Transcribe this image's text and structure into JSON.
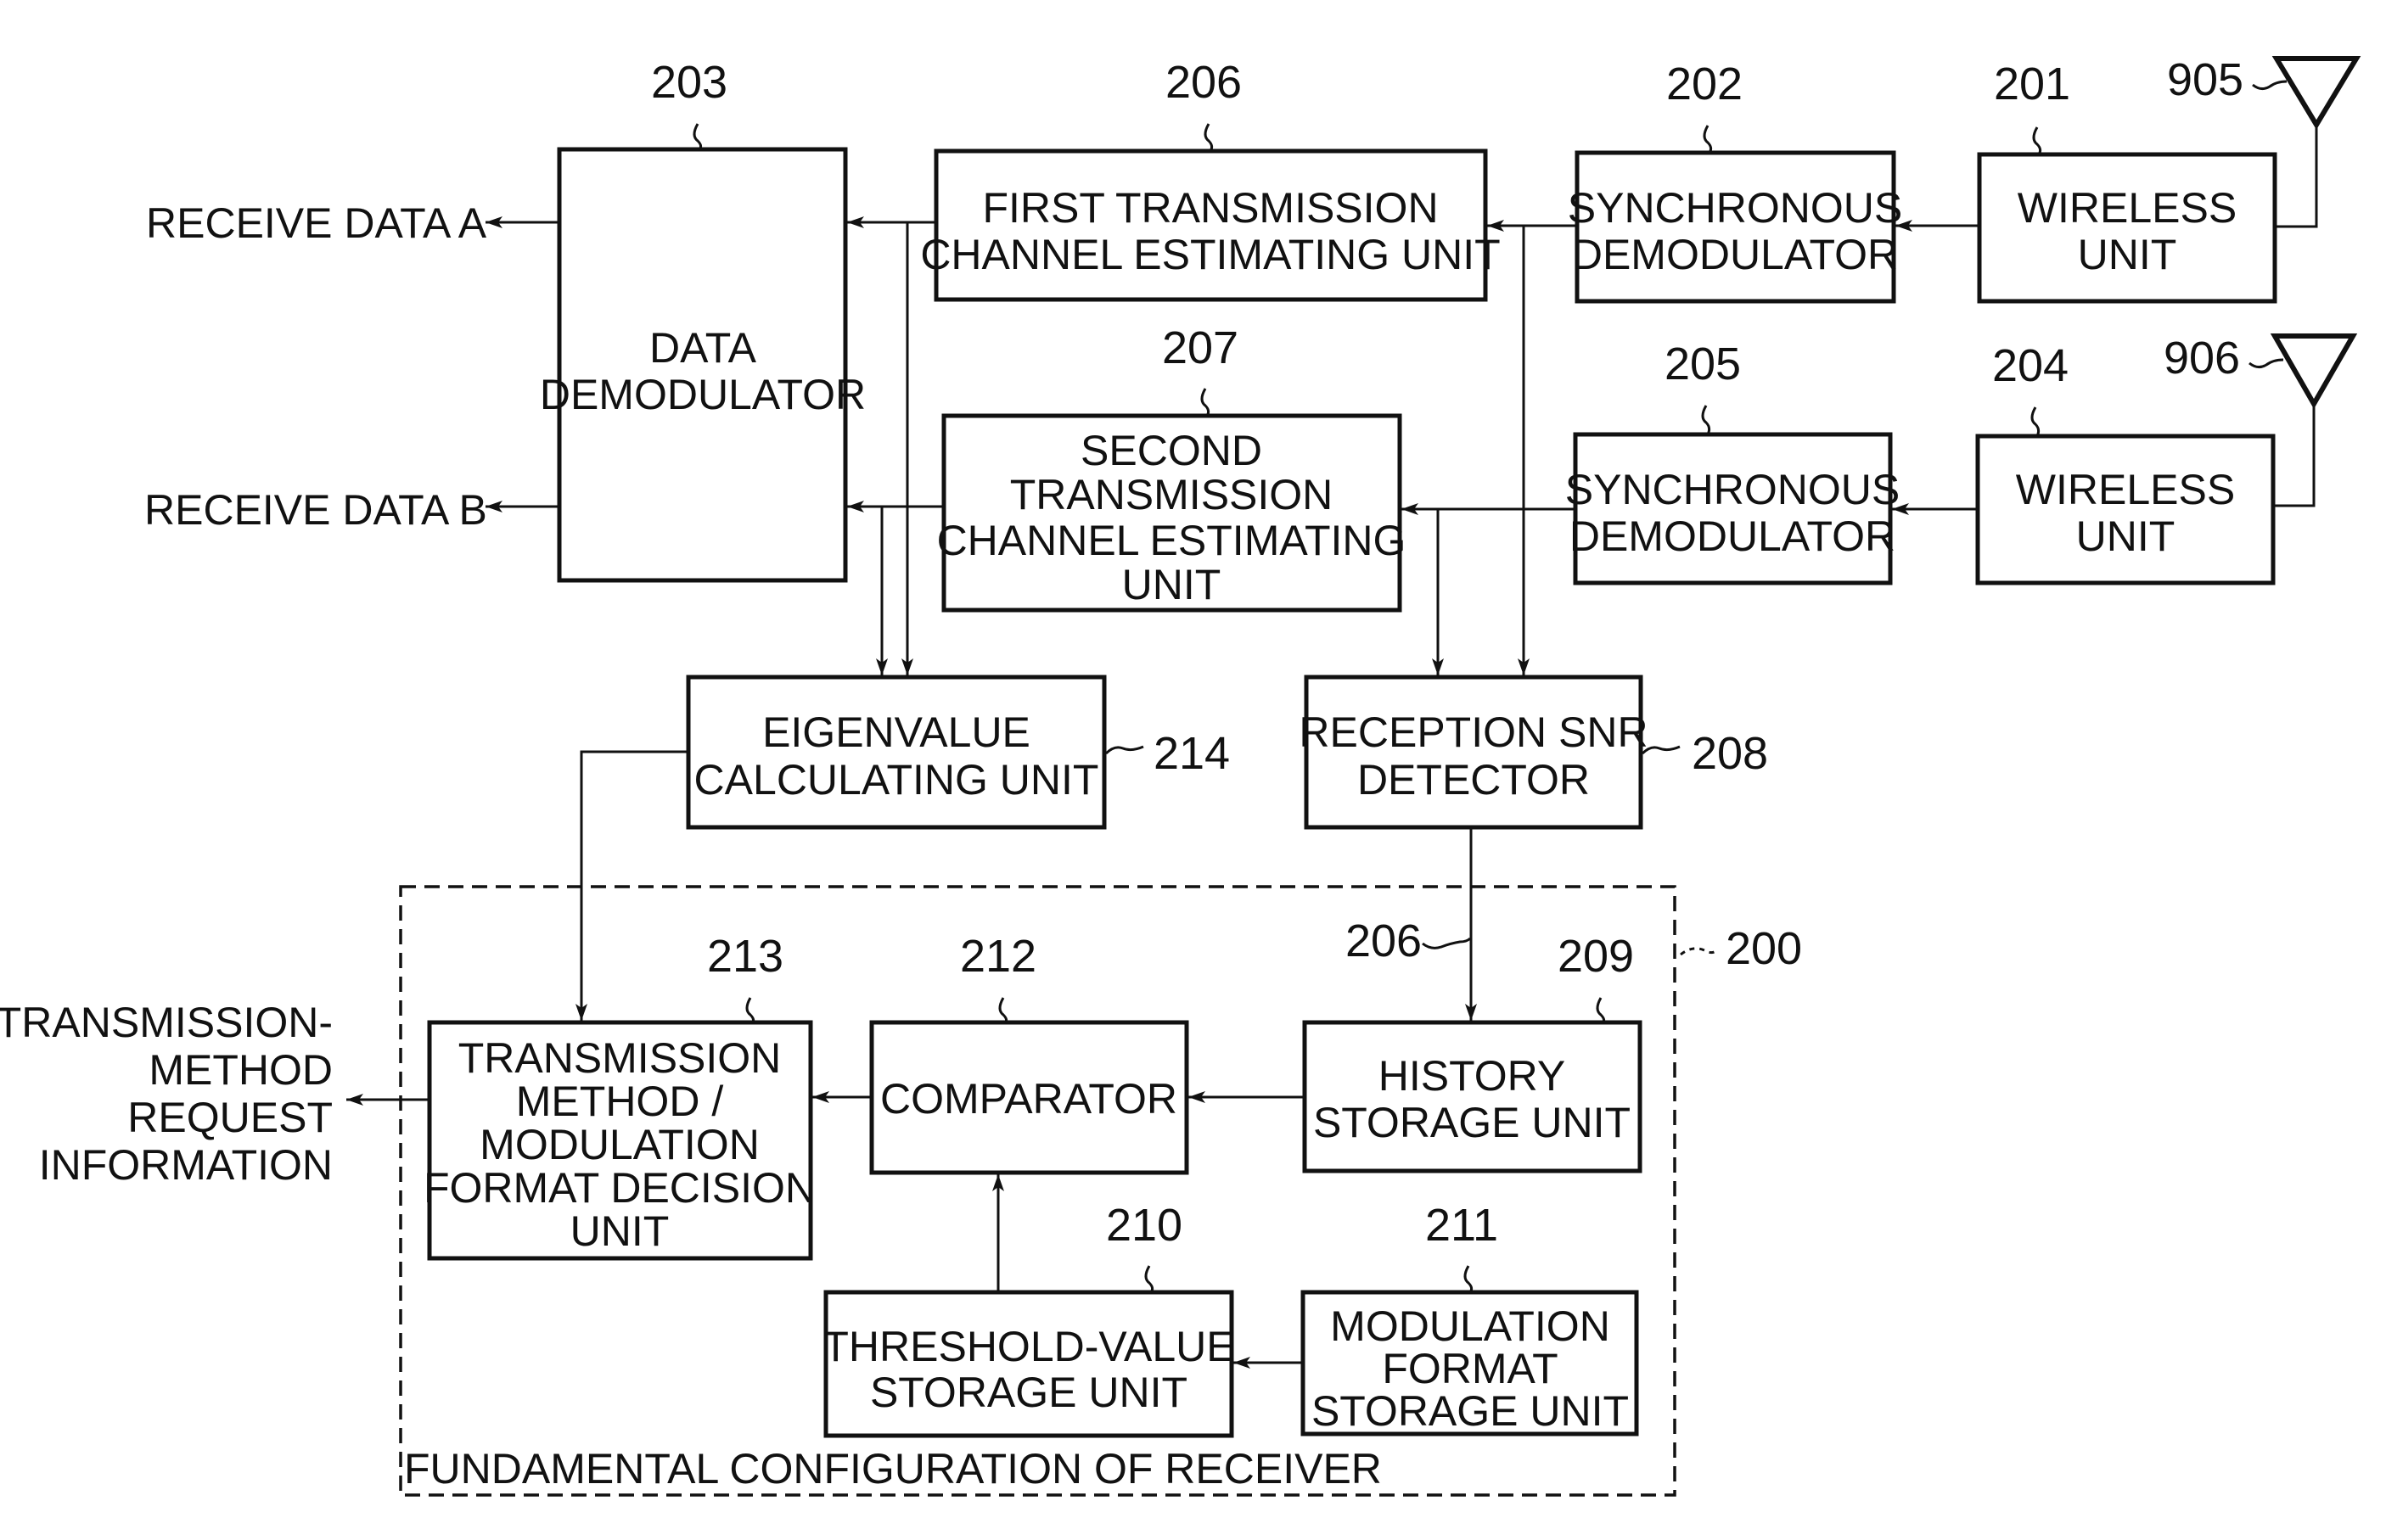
{
  "figure": {
    "container": {
      "ref": "200",
      "caption": "FUNDAMENTAL CONFIGURATION OF RECEIVER"
    },
    "blocks": [
      {
        "id": "data-demodulator",
        "ref": "203",
        "lines": [
          "DATA",
          "DEMODULATOR"
        ]
      },
      {
        "id": "first-channel-estimator",
        "ref": "206",
        "lines": [
          "FIRST TRANSMISSION",
          "CHANNEL ESTIMATING UNIT"
        ]
      },
      {
        "id": "sync-demodulator-1",
        "ref": "202",
        "lines": [
          "SYNCHRONOUS",
          "DEMODULATOR"
        ]
      },
      {
        "id": "wireless-unit-1",
        "ref": "201",
        "lines": [
          "WIRELESS",
          "UNIT"
        ]
      },
      {
        "id": "second-channel-estimator",
        "ref": "207",
        "lines": [
          "SECOND",
          "TRANSMISSION",
          "CHANNEL ESTIMATING",
          "UNIT"
        ]
      },
      {
        "id": "sync-demodulator-2",
        "ref": "205",
        "lines": [
          "SYNCHRONOUS",
          "DEMODULATOR"
        ]
      },
      {
        "id": "wireless-unit-2",
        "ref": "204",
        "lines": [
          "WIRELESS",
          "UNIT"
        ]
      },
      {
        "id": "eigenvalue-unit",
        "ref": "214",
        "lines": [
          "EIGENVALUE",
          "CALCULATING UNIT"
        ]
      },
      {
        "id": "snr-detector",
        "ref": "208",
        "lines": [
          "RECEPTION SNR",
          "DETECTOR"
        ]
      },
      {
        "id": "decision-unit",
        "ref": "213",
        "lines": [
          "TRANSMISSION",
          "METHOD /",
          "MODULATION",
          "FORMAT DECISION",
          "UNIT"
        ]
      },
      {
        "id": "comparator",
        "ref": "212",
        "lines": [
          "COMPARATOR"
        ]
      },
      {
        "id": "history-storage",
        "ref": "209",
        "lines": [
          "HISTORY",
          "STORAGE UNIT"
        ]
      },
      {
        "id": "threshold-storage",
        "ref": "210",
        "lines": [
          "THRESHOLD-VALUE",
          "STORAGE UNIT"
        ]
      },
      {
        "id": "modulation-storage",
        "ref": "211",
        "lines": [
          "MODULATION",
          "FORMAT",
          "STORAGE UNIT"
        ]
      }
    ],
    "antennas": [
      {
        "id": "antenna-1",
        "ref": "905"
      },
      {
        "id": "antenna-2",
        "ref": "906"
      }
    ],
    "outputs": {
      "receive_a": "RECEIVE DATA A",
      "receive_b": "RECEIVE DATA B",
      "request_info": [
        "TRANSMISSION-",
        "METHOD",
        "REQUEST",
        "INFORMATION"
      ]
    },
    "signal_ref": "206"
  }
}
